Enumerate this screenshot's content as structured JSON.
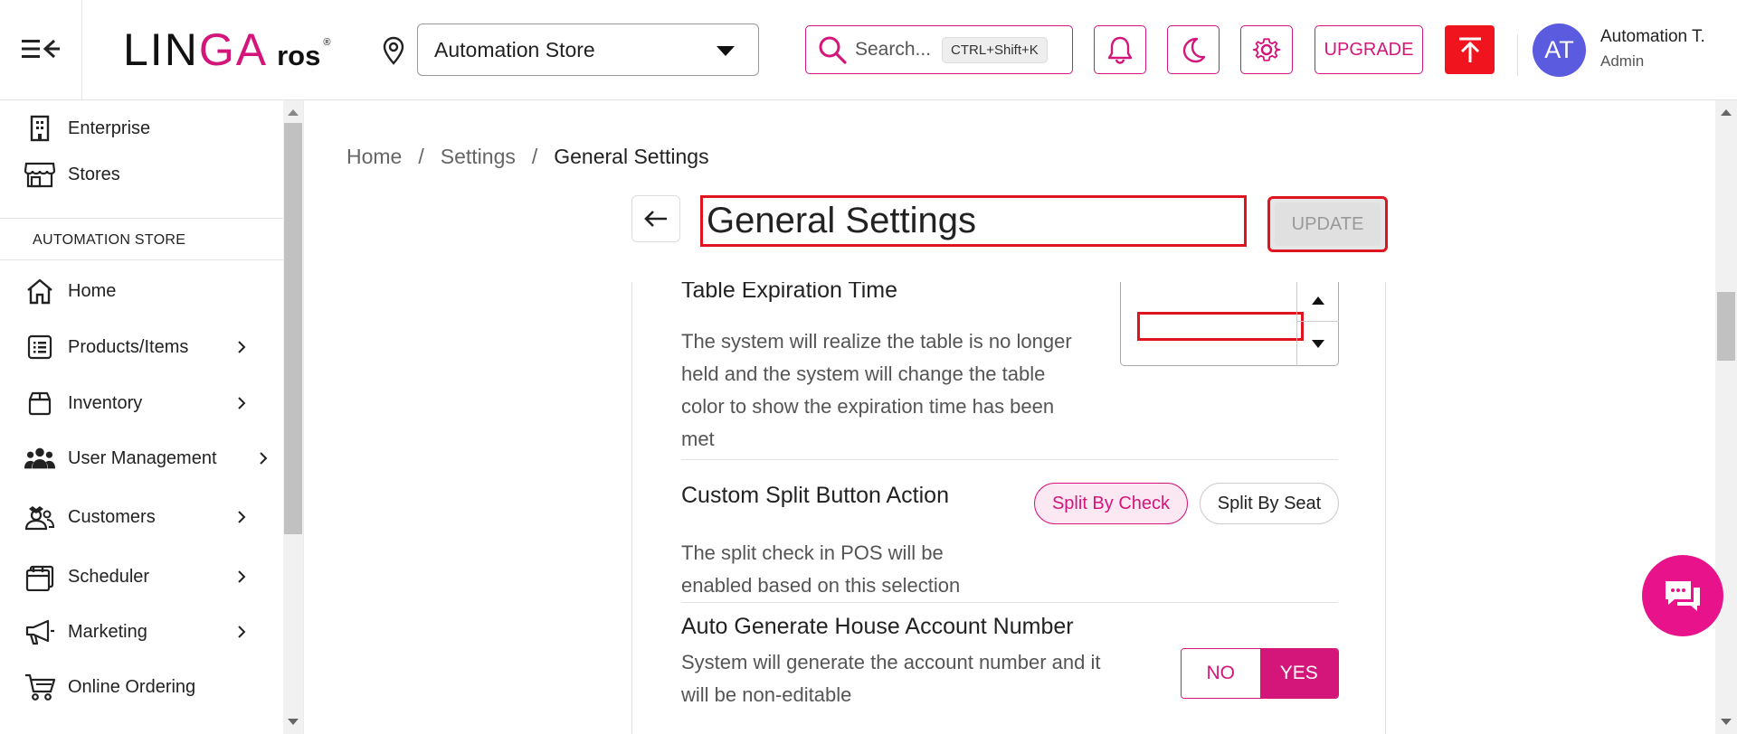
{
  "header": {
    "logo": {
      "part1": "LIN",
      "part2": "GA",
      "part3": "ros",
      "reg": "®"
    },
    "store_name": "Automation Store",
    "search_placeholder": "Search...",
    "search_shortcut": "CTRL+Shift+K",
    "upgrade_label": "UPGRADE",
    "user": {
      "initials": "AT",
      "name": "Automation T.",
      "role": "Admin"
    }
  },
  "sidebar": {
    "top_items": [
      {
        "label": "Enterprise",
        "icon": "building-icon"
      },
      {
        "label": "Stores",
        "icon": "store-icon"
      }
    ],
    "section_label": "AUTOMATION STORE",
    "items": [
      {
        "label": "Home",
        "icon": "home-icon"
      },
      {
        "label": "Products/Items",
        "icon": "list-icon"
      },
      {
        "label": "Inventory",
        "icon": "box-icon"
      },
      {
        "label": "User Management",
        "icon": "users-icon"
      },
      {
        "label": "Customers",
        "icon": "customers-icon"
      },
      {
        "label": "Scheduler",
        "icon": "calendar-icon"
      },
      {
        "label": "Marketing",
        "icon": "megaphone-icon"
      },
      {
        "label": "Online Ordering",
        "icon": "cart-icon"
      }
    ]
  },
  "breadcrumb": {
    "home": "Home",
    "settings": "Settings",
    "current": "General Settings",
    "sep": "/"
  },
  "page": {
    "title": "General Settings",
    "update_label": "UPDATE"
  },
  "settings": {
    "table_expiration": {
      "title": "Table Expiration Time",
      "desc_lines": [
        "The system will realize the table is no longer",
        "held and the system will change the table",
        "color to show the expiration time has been",
        "met"
      ]
    },
    "custom_split": {
      "title": "Custom Split Button Action",
      "options": [
        "Split By Check",
        "Split By Seat"
      ],
      "selected": "Split By Check",
      "desc_lines": [
        "The split check in POS will be",
        "enabled based on this selection"
      ]
    },
    "auto_house": {
      "title": "Auto Generate House Account Number",
      "desc_lines": [
        "System will generate the account number and it",
        "will be non-editable"
      ],
      "no_label": "NO",
      "yes_label": "YES",
      "selected": "YES"
    }
  },
  "colors": {
    "accent": "#d4157a",
    "alert_red": "#f0141e",
    "avatar": "#5b5be0"
  }
}
